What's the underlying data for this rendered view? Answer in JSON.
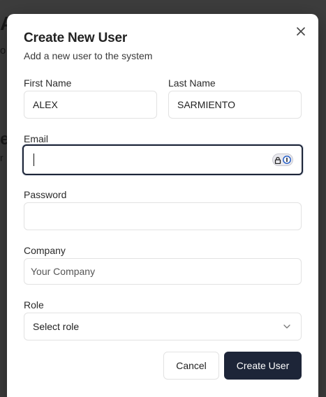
{
  "background": {
    "fragments": [
      "A",
      "o",
      "e",
      "r",
      ""
    ]
  },
  "modal": {
    "title": "Create New User",
    "subtitle": "Add a new user to the system",
    "close_icon": "close-icon",
    "fields": {
      "first_name": {
        "label": "First Name",
        "value": "ALEX"
      },
      "last_name": {
        "label": "Last Name",
        "value": "SARMIENTO"
      },
      "email": {
        "label": "Email",
        "value": ""
      },
      "password": {
        "label": "Password",
        "value": ""
      },
      "company": {
        "label": "Company",
        "placeholder": "Your Company"
      },
      "role": {
        "label": "Role",
        "selected": "Select role"
      }
    },
    "buttons": {
      "cancel": "Cancel",
      "create": "Create User"
    }
  },
  "colors": {
    "primary": "#1d2538",
    "overlay": "#3d3d3d"
  }
}
